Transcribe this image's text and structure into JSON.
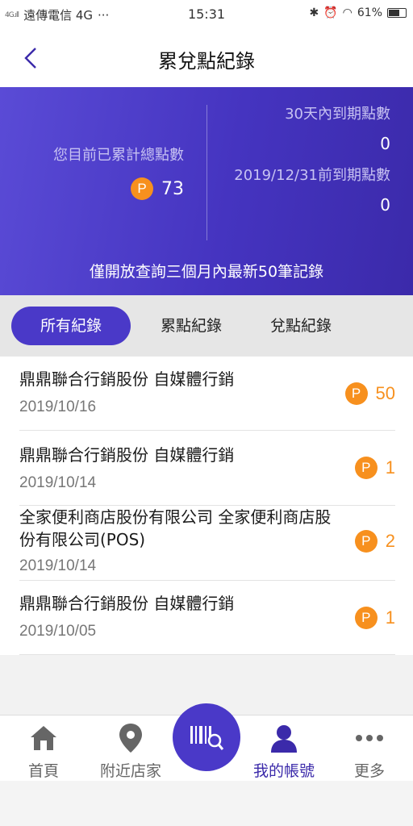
{
  "status_bar": {
    "network": "4G",
    "carrier": "遠傳電信 4G",
    "dots": "···",
    "time": "15:31",
    "battery": "61%"
  },
  "nav": {
    "back_icon": "chevron-left-icon",
    "title": "累兌點紀錄"
  },
  "summary": {
    "total_label": "您目前已累計總點數",
    "total_points": "73",
    "badge": "P",
    "expire_30_label": "30天內到期點數",
    "expire_30_value": "0",
    "expire_date_label": "2019/12/31前到期點數",
    "expire_date_value": "0",
    "note": "僅開放查詢三個月內最新50筆記錄"
  },
  "tabs": [
    {
      "label": "所有紀錄",
      "active": true
    },
    {
      "label": "累點紀錄",
      "active": false
    },
    {
      "label": "兌點紀錄",
      "active": false
    }
  ],
  "records": [
    {
      "name": "鼎鼎聯合行銷股份 自媒體行銷",
      "date": "2019/10/16",
      "points": "50"
    },
    {
      "name": "鼎鼎聯合行銷股份 自媒體行銷",
      "date": "2019/10/14",
      "points": "1"
    },
    {
      "name": "全家便利商店股份有限公司 全家便利商店股份有限公司(POS)",
      "date": "2019/10/14",
      "points": "2"
    },
    {
      "name": "鼎鼎聯合行銷股份 自媒體行銷",
      "date": "2019/10/05",
      "points": "1"
    }
  ],
  "tabbar": {
    "home": "首頁",
    "nearby": "附近店家",
    "scan_icon": "barcode-scan-icon",
    "account": "我的帳號",
    "more": "更多"
  },
  "colors": {
    "accent": "#4a39c8",
    "points_orange": "#f7901e",
    "hero_gradient_start": "#5a4bd6",
    "hero_gradient_end": "#3b2aaa"
  }
}
